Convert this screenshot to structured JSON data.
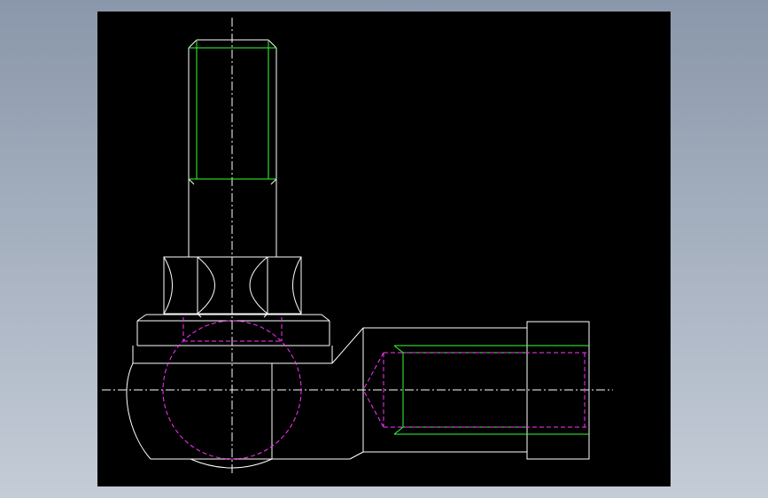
{
  "window": {
    "background_top": "#8a97aa",
    "background_bottom": "#c4ccd7"
  },
  "viewport": {
    "background": "#000000"
  },
  "drawing": {
    "subject": "ball-joint-rod-end",
    "colors": {
      "outline": "#ffffff",
      "thread": "#33ff33",
      "hidden": "#ff33ff",
      "centerline": "#ffffff"
    },
    "views": [
      "stud-view",
      "side-view"
    ]
  }
}
